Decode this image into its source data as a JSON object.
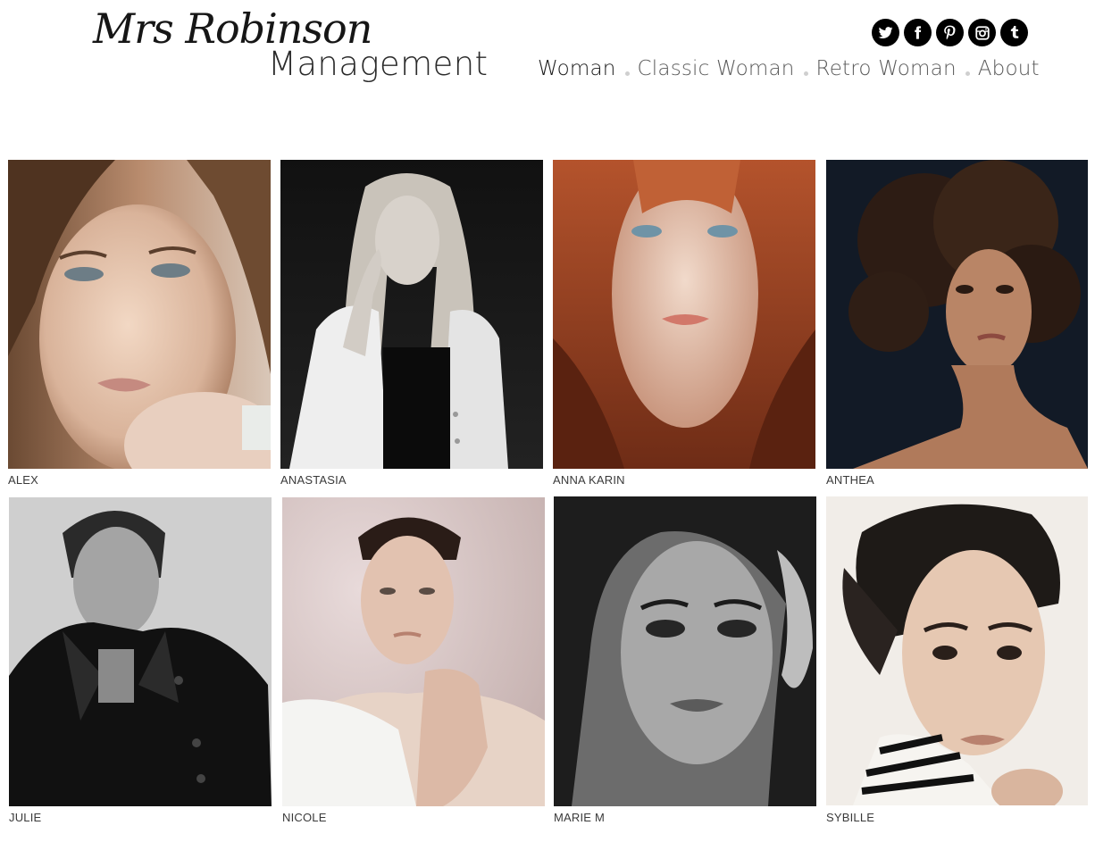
{
  "header": {
    "logo_script": "Mrs Robinson",
    "logo_main": "Management"
  },
  "social": [
    {
      "name": "twitter",
      "icon": "twitter-icon"
    },
    {
      "name": "facebook",
      "icon": "facebook-icon"
    },
    {
      "name": "pinterest",
      "icon": "pinterest-icon"
    },
    {
      "name": "instagram",
      "icon": "instagram-icon"
    },
    {
      "name": "tumblr",
      "icon": "tumblr-icon"
    }
  ],
  "nav": {
    "items": [
      {
        "label": "Woman",
        "active": true
      },
      {
        "label": "Classic Woman",
        "active": false
      },
      {
        "label": "Retro Woman",
        "active": false
      },
      {
        "label": "About",
        "active": false
      }
    ]
  },
  "models": [
    {
      "name": "ALEX",
      "photo": "portrait, brown hair, warm skin, light background"
    },
    {
      "name": "ANASTASIA",
      "photo": "black and white, blonde hair, white blazer"
    },
    {
      "name": "ANNA KARIN",
      "photo": "red hair, freckles, blue eyes"
    },
    {
      "name": "ANTHEA",
      "photo": "curly dark hair, dark background"
    },
    {
      "name": "JULIE",
      "photo": "black and white, leather jacket"
    },
    {
      "name": "NICOLE",
      "photo": "hair tied back, hands clasped, white top"
    },
    {
      "name": "MARIE M",
      "photo": "black and white, dark hair, hand in hair"
    },
    {
      "name": "SYBILLE",
      "photo": "dark updo, striped top"
    }
  ]
}
